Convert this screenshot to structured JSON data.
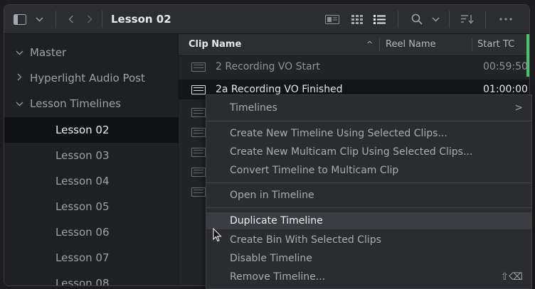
{
  "toolbar": {
    "title": "Lesson 02",
    "icons": [
      "sidebar-toggle-icon",
      "chevron-down-icon",
      "back-arrow-icon",
      "forward-arrow-icon",
      "thumbnail-view-icon",
      "grid-view-icon",
      "list-view-icon",
      "search-icon",
      "chevron-down-icon",
      "sort-icon",
      "more-options-icon"
    ]
  },
  "sidebar": {
    "root": "Master",
    "items": [
      {
        "label": "Hyperlight Audio Post"
      },
      {
        "label": "Lesson Timelines"
      },
      {
        "label": "Lesson 02"
      },
      {
        "label": "Lesson 03"
      },
      {
        "label": "Lesson 04"
      },
      {
        "label": "Lesson 05"
      },
      {
        "label": "Lesson 06"
      },
      {
        "label": "Lesson 07"
      },
      {
        "label": "Lesson 08"
      }
    ]
  },
  "list": {
    "columns": {
      "clip_name": "Clip Name",
      "reel_name": "Reel Name",
      "start_tc": "Start TC"
    },
    "sort_indicator": "^",
    "rows": [
      {
        "name": "2 Recording VO Start",
        "start_tc": "00:59:50"
      },
      {
        "name": "2a Recording VO Finished",
        "start_tc": "01:00:00"
      }
    ]
  },
  "context_menu": {
    "timelines": "Timelines",
    "submenu_arrow": ">",
    "create_timeline": "Create New Timeline Using Selected Clips...",
    "create_multicam": "Create New Multicam Clip Using Selected Clips...",
    "convert_multicam": "Convert Timeline to Multicam Clip",
    "open_in_timeline": "Open in Timeline",
    "duplicate_timeline": "Duplicate Timeline",
    "create_bin": "Create Bin With Selected Clips",
    "disable_timeline": "Disable Timeline",
    "remove_timeline": "Remove Timeline...",
    "remove_shortcut": "⇧⌫"
  },
  "colors": {
    "accent_green": "#45c46c",
    "selection": "#111214"
  }
}
